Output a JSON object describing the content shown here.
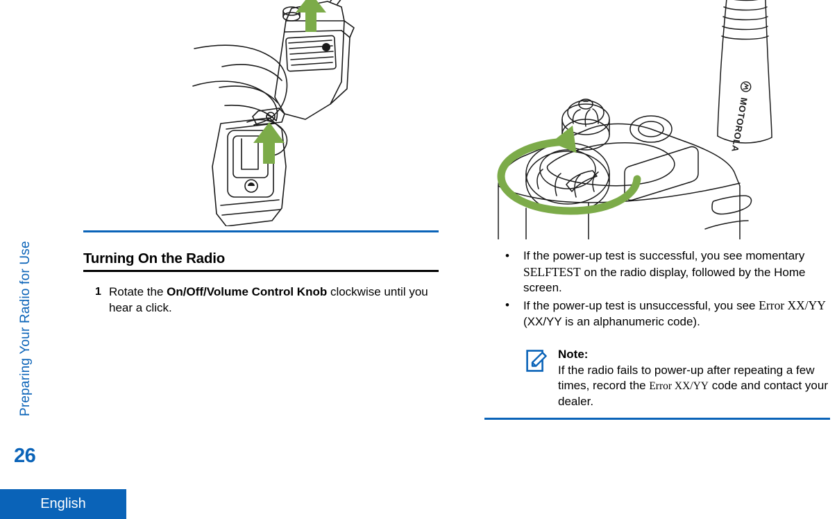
{
  "document": {
    "running_head": "Preparing Your Radio for Use",
    "page_number": "26",
    "language_tab": "English",
    "accent_blue": "#0A63B8",
    "arrow_green": "#7CAB49"
  },
  "left_column": {
    "illustration": {
      "name": "hand-attaching-belt-clip-to-radio",
      "arrows": [
        "up-arrow-antenna",
        "up-arrow-belt-clip"
      ]
    },
    "heading": "Turning On the Radio",
    "steps": [
      {
        "number": "1",
        "text_before": "Rotate the ",
        "bold": "On/Off/Volume Control Knob",
        "text_after": " clockwise until you hear a click."
      }
    ]
  },
  "right_column": {
    "illustration": {
      "name": "radio-top-volume-knob-rotate",
      "brand": "MOTOROLA",
      "arrows": [
        "circular-clockwise-arrow-knob"
      ]
    },
    "bullets": [
      {
        "part1": "If the power-up test is successful, you see momentary ",
        "screen_text": "SELFTEST",
        "part2": " on the radio display, followed by the Home screen."
      },
      {
        "part1": "If the power-up test is unsuccessful, you see ",
        "screen_text": "Error XX/YY",
        "part2": " (XX/YY is an alphanumeric code)."
      }
    ],
    "note": {
      "icon": "note-pencil-icon",
      "title": "Note:",
      "part1": "If the radio fails to power-up after repeating a few times, record the ",
      "screen_text": "Error XX/YY",
      "part2": " code and contact your dealer."
    }
  }
}
